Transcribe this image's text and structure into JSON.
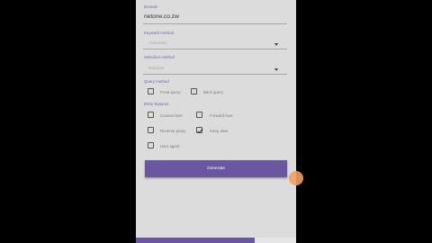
{
  "form": {
    "domain_label": "Domain",
    "domain_value": "netone.co.zw",
    "keyword_label": "Keyword method",
    "keyword_value": "Automatic",
    "selection_label": "Selection method",
    "selection_value": "Random",
    "query_label": "Query method",
    "query_options": [
      {
        "label": "Front query",
        "checked": false
      },
      {
        "label": "Back query",
        "checked": false
      }
    ],
    "entry_label": "Entry features",
    "entry_options": [
      {
        "label": "Custom host",
        "checked": false
      },
      {
        "label": "Forward host",
        "checked": false
      },
      {
        "label": "Reverse proxy",
        "checked": false
      },
      {
        "label": "Keep alive",
        "checked": true
      },
      {
        "label": "User agent",
        "checked": false
      }
    ],
    "generate_label": "Generate"
  },
  "colors": {
    "accent": "#6b57a0",
    "fab": "#f0a060"
  }
}
